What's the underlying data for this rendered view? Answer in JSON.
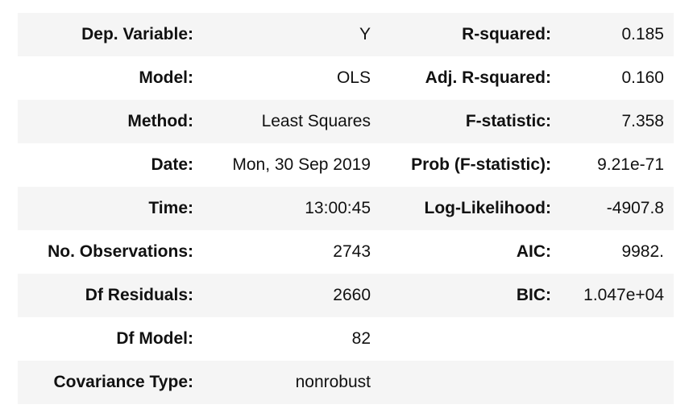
{
  "summary_rows": [
    {
      "label_left": "Dep. Variable:",
      "value_left": "Y",
      "label_right": "R-squared:",
      "value_right": "0.185"
    },
    {
      "label_left": "Model:",
      "value_left": "OLS",
      "label_right": "Adj. R-squared:",
      "value_right": "0.160"
    },
    {
      "label_left": "Method:",
      "value_left": "Least Squares",
      "label_right": "F-statistic:",
      "value_right": "7.358"
    },
    {
      "label_left": "Date:",
      "value_left": "Mon, 30 Sep 2019",
      "label_right": "Prob (F-statistic):",
      "value_right": "9.21e-71"
    },
    {
      "label_left": "Time:",
      "value_left": "13:00:45",
      "label_right": "Log-Likelihood:",
      "value_right": "-4907.8"
    },
    {
      "label_left": "No. Observations:",
      "value_left": "2743",
      "label_right": "AIC:",
      "value_right": "9982."
    },
    {
      "label_left": "Df Residuals:",
      "value_left": "2660",
      "label_right": "BIC:",
      "value_right": "1.047e+04"
    },
    {
      "label_left": "Df Model:",
      "value_left": "82",
      "label_right": "",
      "value_right": ""
    },
    {
      "label_left": "Covariance Type:",
      "value_left": "nonrobust",
      "label_right": "",
      "value_right": ""
    }
  ],
  "colors": {
    "row_shade": "#f5f5f5",
    "text": "#111111"
  }
}
